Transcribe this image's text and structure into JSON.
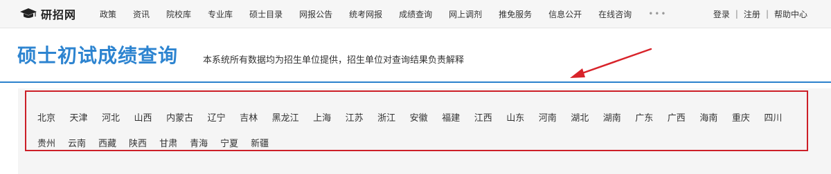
{
  "brand": {
    "name": "研招网",
    "icon": "graduation-cap-icon"
  },
  "nav": {
    "items": [
      "政策",
      "资讯",
      "院校库",
      "专业库",
      "硕士目录",
      "网报公告",
      "统考网报",
      "成绩查询",
      "网上调剂",
      "推免服务",
      "信息公开",
      "在线咨询"
    ],
    "more": "•••"
  },
  "user_links": {
    "login": "登录",
    "sep": "|",
    "register": "注册",
    "help": "帮助中心"
  },
  "page": {
    "title": "硕士初试成绩查询",
    "description": "本系统所有数据均为招生单位提供，招生单位对查询结果负责解释"
  },
  "provinces": {
    "row1": [
      "北京",
      "天津",
      "河北",
      "山西",
      "内蒙古",
      "辽宁",
      "吉林",
      "黑龙江",
      "上海",
      "江苏",
      "浙江",
      "安徽",
      "福建",
      "江西",
      "山东",
      "河南",
      "湖北",
      "湖南",
      "广东",
      "广西",
      "海南",
      "重庆",
      "四川"
    ],
    "row2": [
      "贵州",
      "云南",
      "西藏",
      "陕西",
      "甘肃",
      "青海",
      "宁夏",
      "新疆"
    ]
  },
  "colors": {
    "accent": "#2d84d0",
    "highlight": "#cc1f27",
    "panel": "#f5f5f5"
  }
}
